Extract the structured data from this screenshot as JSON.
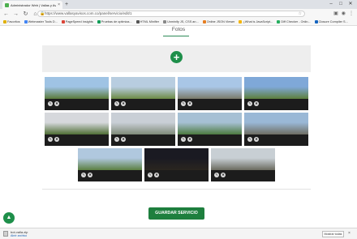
{
  "browser": {
    "tab_title": "Administrador Web | Vallas y Av...",
    "tab_close": "×",
    "new_tab": "+",
    "url": "https://www.vallasyavisos.com.co/panel/servicio/edit/1",
    "bookmarks": [
      {
        "label": "Favoritos",
        "color": "#e0b000"
      },
      {
        "label": "Webmaster Tools D...",
        "color": "#4285f4"
      },
      {
        "label": "PageSpeed Insights",
        "color": "#db4437"
      },
      {
        "label": "Pruebas de optimiza...",
        "color": "#0f9d58"
      },
      {
        "label": "HTML Minifier",
        "color": "#555555"
      },
      {
        "label": "Unminify JS, CSS an...",
        "color": "#888888"
      },
      {
        "label": "Online JSON Viewer",
        "color": "#e67e22"
      },
      {
        "label": "¿What is JavaScript...",
        "color": "#f4b400"
      },
      {
        "label": "Diff Checker - Onlin...",
        "color": "#27ae60"
      },
      {
        "label": "Closure Compiler S...",
        "color": "#1565c0"
      }
    ]
  },
  "page": {
    "section_title": "Fotos",
    "add_button": "+",
    "save_button": "GUARDAR SERVICIO",
    "scroll_top": "^"
  },
  "download_bar": {
    "file_name": "bot-valla.zip",
    "file_link": "Abrir archivo",
    "show_all": "Mostrar todas",
    "close": "×"
  },
  "photos": [
    {
      "sky": "#9fc3e4",
      "ground": "#5a7a3a"
    },
    {
      "sky": "#b8cde0",
      "ground": "#6d8b45"
    },
    {
      "sky": "#a9c6e6",
      "ground": "#7a7a6a"
    },
    {
      "sky": "#7fa8d8",
      "ground": "#5d7f3c"
    },
    {
      "sky": "#d6d8dc",
      "ground": "#4f6e35"
    },
    {
      "sky": "#c9cfd6",
      "ground": "#7f8a78"
    },
    {
      "sky": "#a6c0d4",
      "ground": "#4c7a3f"
    },
    {
      "sky": "#9ab8d6",
      "ground": "#6e6e62"
    },
    {
      "sky": "#b0c8de",
      "ground": "#5b7f40"
    },
    {
      "sky": "#1a1a22",
      "ground": "#2b2620"
    },
    {
      "sky": "#c8cfd4",
      "ground": "#6a6a5e"
    }
  ]
}
